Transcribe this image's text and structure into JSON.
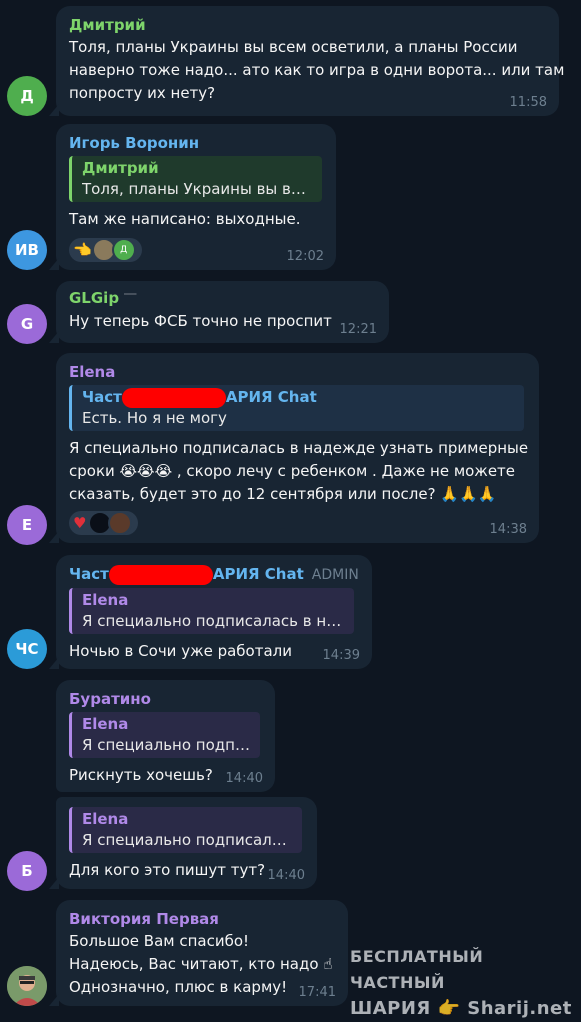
{
  "messages": [
    {
      "avatar": {
        "initials": "Д",
        "color": "#4fae4e"
      },
      "author": "Дмитрий",
      "author_color": "#7ed46b",
      "lines": [
        "Толя, планы Украины вы всем осветили, а планы России",
        "наверно тоже надо... ато как то игра в одни ворота... или там",
        "попросту их нету?"
      ],
      "time": "11:58"
    },
    {
      "avatar": {
        "initials": "ИВ",
        "color": "#3d97e0"
      },
      "author": "Игорь Воронин",
      "author_color": "#64b5ef",
      "reply": {
        "author": "Дмитрий",
        "text": "Толя, планы Украины вы все..."
      },
      "lines": [
        "Там же написано: выходные."
      ],
      "reactions": [
        "👈",
        "avatar",
        "Д"
      ],
      "time": "12:02"
    },
    {
      "avatar": {
        "initials": "G",
        "color": "#9b6ad8"
      },
      "author": "GLGip",
      "author_color": "#7ed46b",
      "lines": [
        "Ну теперь ФСБ точно не проспит"
      ],
      "time": "12:21"
    },
    {
      "avatar": {
        "initials": "E",
        "color": "#9b6ad8"
      },
      "author": "Elena",
      "author_color": "#b089e8",
      "reply": {
        "author_pre": "Част",
        "author_post": "АРИЯ Chat",
        "text": "Есть. Но я не могу"
      },
      "lines": [
        "Я специально подписалась в надежде узнать примерные",
        "сроки 😭😭😭  , скоро лечу с ребенком . Даже не можете",
        "сказать, будет это до 12 сентября или после? 🙏🙏🙏"
      ],
      "reactions": [
        "♥",
        "avatar",
        "avatar"
      ],
      "time": "14:38"
    },
    {
      "avatar": {
        "initials": "ЧС",
        "color": "#2b9bd8"
      },
      "author_pre": "Част",
      "author_post": "АРИЯ Chat",
      "author_color": "#64b5ef",
      "badge": "ADMIN",
      "reply": {
        "author": "Elena",
        "text": "Я специально подписалась в над..."
      },
      "lines": [
        "Ночью в Сочи уже работали"
      ],
      "time": "14:39"
    },
    {
      "author": "Буратино",
      "author_color": "#b089e8",
      "reply": {
        "author": "Elena",
        "text": "Я специально подпи..."
      },
      "lines": [
        "Рискнуть хочешь?"
      ],
      "time": "14:40"
    },
    {
      "avatar": {
        "initials": "Б",
        "color": "#9b6ad8"
      },
      "reply": {
        "author": "Elena",
        "text": "Я специально подписала..."
      },
      "lines": [
        "Для кого это пишут тут?"
      ],
      "time": "14:40"
    },
    {
      "author": "Виктория Первая",
      "author_color": "#b089e8",
      "lines": [
        "Большое Вам спасибо!",
        "Надеюсь, Вас читают, кто надо ☝",
        "Однозначно, плюс в карму!"
      ],
      "time": "17:41"
    }
  ],
  "watermark": {
    "line1": "БЕСПЛАТНЫЙ ЧАСТНЫЙ",
    "line2": "ШАРИЯ 👉 Sharij.net"
  },
  "colors": {
    "background": "#0e1621",
    "bubble": "#182533",
    "time": "#6d7f8f",
    "redaction": "#ff0000"
  }
}
